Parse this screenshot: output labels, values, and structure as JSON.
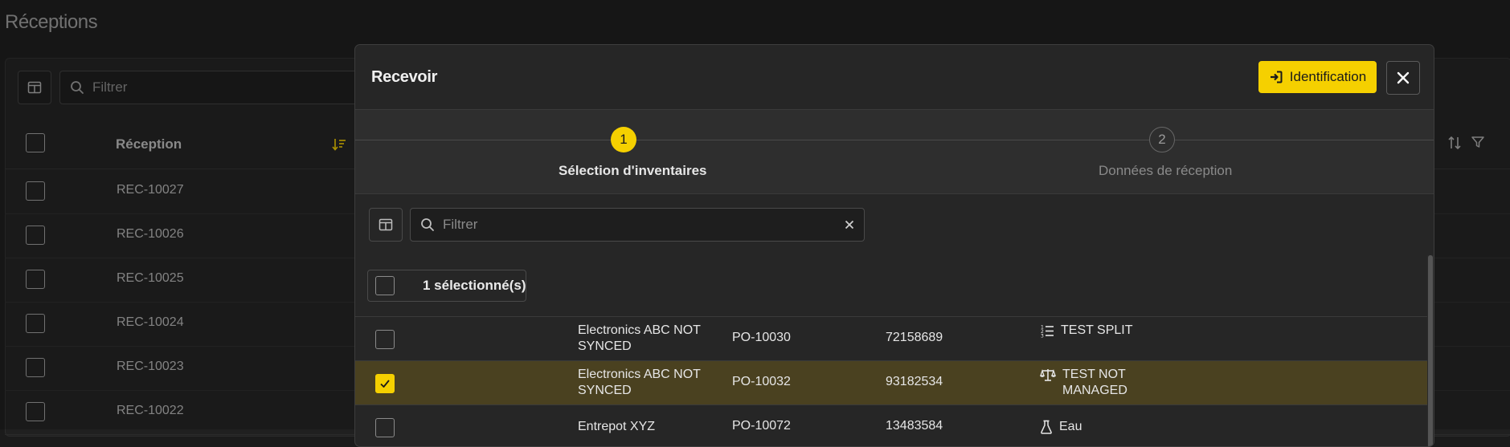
{
  "page": {
    "title": "Réceptions"
  },
  "background_table": {
    "filter_placeholder": "Filtrer",
    "column_header": "Réception",
    "rows": [
      "REC-10027",
      "REC-10026",
      "REC-10025",
      "REC-10024",
      "REC-10023",
      "REC-10022"
    ]
  },
  "modal": {
    "title": "Recevoir",
    "identification_label": "Identification",
    "steps": [
      {
        "number": "1",
        "label": "Sélection d'inventaires",
        "active": true
      },
      {
        "number": "2",
        "label": "Données de réception",
        "active": false
      }
    ],
    "filter_placeholder": "Filtrer",
    "selected_count_label": "1 sélectionné(s)",
    "rows": [
      {
        "name": "Electronics ABC NOT SYNCED",
        "po": "PO-10030",
        "number": "72158689",
        "type": "TEST SPLIT",
        "type_icon": "list-numbered-icon",
        "selected": false
      },
      {
        "name": "Electronics ABC NOT SYNCED",
        "po": "PO-10032",
        "number": "93182534",
        "type": "TEST NOT MANAGED",
        "type_icon": "scale-icon",
        "selected": true
      },
      {
        "name": "Entrepot XYZ",
        "po": "PO-10072",
        "number": "13483584",
        "type": "Eau",
        "type_icon": "flask-icon",
        "selected": false
      }
    ]
  },
  "colors": {
    "accent": "#f5d000",
    "selected_row": "#4a4120",
    "background": "#1b1b1b",
    "modal": "#262626"
  }
}
